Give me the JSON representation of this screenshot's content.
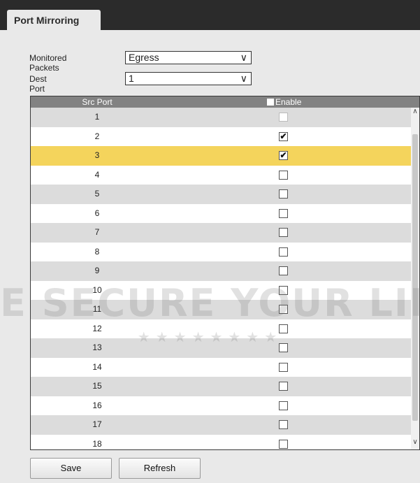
{
  "tab": {
    "label": "Port Mirroring"
  },
  "form": {
    "monitored_packets": {
      "label": "Monitored Packets",
      "value": "Egress"
    },
    "dest_port": {
      "label": "Dest Port",
      "value": "1"
    }
  },
  "table": {
    "headers": {
      "src_port": "Src Port",
      "enable": "Enable"
    },
    "rows": [
      {
        "port": "1",
        "enabled": false,
        "disabled": true
      },
      {
        "port": "2",
        "enabled": true
      },
      {
        "port": "3",
        "enabled": true,
        "selected": true
      },
      {
        "port": "4",
        "enabled": false
      },
      {
        "port": "5",
        "enabled": false
      },
      {
        "port": "6",
        "enabled": false
      },
      {
        "port": "7",
        "enabled": false
      },
      {
        "port": "8",
        "enabled": false
      },
      {
        "port": "9",
        "enabled": false
      },
      {
        "port": "10",
        "enabled": false
      },
      {
        "port": "11",
        "enabled": false
      },
      {
        "port": "12",
        "enabled": false
      },
      {
        "port": "13",
        "enabled": false
      },
      {
        "port": "14",
        "enabled": false
      },
      {
        "port": "15",
        "enabled": false
      },
      {
        "port": "16",
        "enabled": false
      },
      {
        "port": "17",
        "enabled": false
      },
      {
        "port": "18",
        "enabled": false
      }
    ]
  },
  "buttons": {
    "save": "Save",
    "refresh": "Refresh"
  },
  "watermark": {
    "text": "E SECURE YOUR LIFE"
  },
  "colors": {
    "highlight": "#f4d45c",
    "header": "#828282",
    "topbar": "#2b2b2b"
  }
}
